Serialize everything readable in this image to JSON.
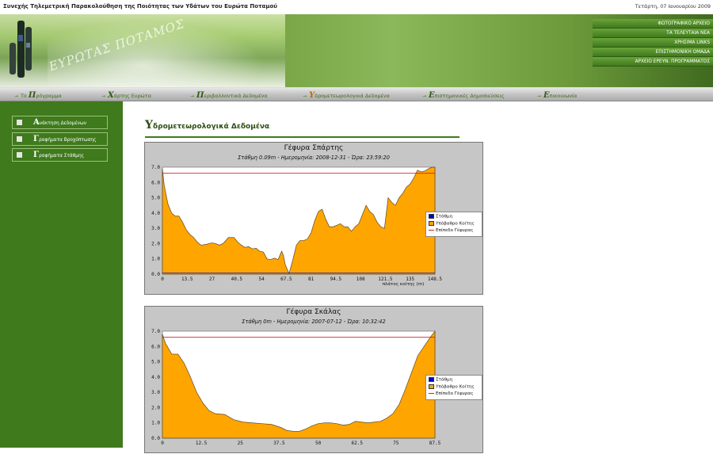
{
  "header": {
    "site_title": "Συνεχής Τηλεμετρική Παρακολούθηση της Ποιότητας των Υδάτων του Ευρώτα Ποταμού",
    "date": "Τετάρτη, 07 Ιανουαρίου 2009"
  },
  "banner": {
    "logo_text": "ΕΥΡΩΤΑΣ ΠΟΤΑΜΟΣ",
    "links": [
      "ΦΩΤΟΓΡΑΦΙΚΟ ΑΡΧΕΙΟ",
      "ΤΑ ΤΕΛΕΥΤΑΙΑ ΝΕΑ",
      "ΧΡΗΣΙΜΑ LINKS",
      "ΕΠΙΣΤΗΜΟΝΙΚΗ ΟΜΑΔΑ",
      "ΑΡΧΕΙΟ ΕΡΕΥΝ. ΠΡΟΓΡΑΜΜΑΤΟΣ"
    ]
  },
  "menu": {
    "items": [
      {
        "prefix": "Το",
        "initial": "Π",
        "rest": "ρόγραμμα",
        "active": false
      },
      {
        "prefix": "",
        "initial": "Χ",
        "rest": "άρτης Ευρώτα",
        "active": false
      },
      {
        "prefix": "",
        "initial": "Π",
        "rest": "εριβαλλοντικά Δεδομένα",
        "active": false
      },
      {
        "prefix": "",
        "initial": "Υ",
        "rest": "δρομετεωρολογικά Δεδομένα",
        "active": true
      },
      {
        "prefix": "",
        "initial": "Ε",
        "rest": "πιστημονικές Δημοσιεύσεις",
        "active": false
      },
      {
        "prefix": "",
        "initial": "Ε",
        "rest": "πικοινωνία",
        "active": false
      }
    ]
  },
  "sidebar": {
    "items": [
      {
        "initial": "Α",
        "rest": "νάκτηση Δεδομένων"
      },
      {
        "initial": "Γ",
        "rest": "ραφήματα Βροχόπτωσης"
      },
      {
        "initial": "Γ",
        "rest": "ραφήματα Στάθμης"
      }
    ]
  },
  "content": {
    "title_initial": "Υ",
    "title_rest": "δρομετεωρολογικά Δεδομένα"
  },
  "colors": {
    "green_dark": "#3f7a1d",
    "fill_orange": "#ffa500",
    "stage_blue": "#0000cc",
    "bridge_red": "#cc2222",
    "panel_grey": "#c6c6c6"
  },
  "chart_data": [
    {
      "type": "area",
      "title": "Γέφυρα Σπάρτης",
      "subtitle": "Στάθμη 0.09m - Ημερομηνία: 2008-12-31 - Ώρα: 23:59:20",
      "xlabel": "πλάτος κοίτης (m)",
      "ylabel": "",
      "xlim": [
        0,
        148.5
      ],
      "ylim": [
        0,
        7
      ],
      "xticks": [
        "0",
        "13.5",
        "27",
        "40.5",
        "54",
        "67.5",
        "81",
        "94.5",
        "108",
        "121.5",
        "135",
        "148.5"
      ],
      "yticks": [
        "0.0",
        "1.0",
        "2.0",
        "3.0",
        "4.0",
        "5.0",
        "6.0",
        "7.0"
      ],
      "legend": [
        "Στάθμη",
        "Υπόβαθρο Κοίτης",
        "Επίπεδο Γέφυρας"
      ],
      "bridge_level": 6.6,
      "stage": 0.09,
      "x": [
        0,
        1,
        3,
        5,
        7,
        9,
        11,
        13,
        15,
        17,
        19,
        21,
        24,
        27,
        29,
        31,
        33,
        36,
        39,
        41,
        43,
        45,
        47,
        49,
        51,
        53,
        55,
        57,
        59,
        61,
        63,
        65,
        66,
        67,
        69,
        71,
        73,
        75,
        77,
        79,
        81,
        83,
        85,
        87,
        89,
        91,
        93,
        95,
        97,
        99,
        101,
        103,
        105,
        107,
        109,
        111,
        113,
        115,
        117,
        119,
        121,
        123,
        125,
        127,
        129,
        131,
        133,
        135,
        137,
        139,
        141,
        143,
        145,
        147,
        148.5
      ],
      "y": [
        6.9,
        5.8,
        4.6,
        4.0,
        3.8,
        3.8,
        3.4,
        2.9,
        2.6,
        2.4,
        2.1,
        1.9,
        1.95,
        2.05,
        2.0,
        1.9,
        2.0,
        2.4,
        2.4,
        2.1,
        1.9,
        1.75,
        1.8,
        1.65,
        1.7,
        1.5,
        1.45,
        1.0,
        0.95,
        1.05,
        0.95,
        1.5,
        1.2,
        0.6,
        0.05,
        0.9,
        1.9,
        2.2,
        2.2,
        2.3,
        2.7,
        3.5,
        4.1,
        4.25,
        3.6,
        3.1,
        3.1,
        3.2,
        3.3,
        3.1,
        3.1,
        2.8,
        3.1,
        3.3,
        3.9,
        4.5,
        4.1,
        3.9,
        3.4,
        3.1,
        3.0,
        5.0,
        4.7,
        4.5,
        5.0,
        5.3,
        5.7,
        5.9,
        6.3,
        6.8,
        6.7,
        6.75,
        6.9,
        7.0,
        7.0
      ]
    },
    {
      "type": "area",
      "title": "Γέφυρα Σκάλας",
      "subtitle": "Στάθμη 0m - Ημερομηνία: 2007-07-12 - Ώρα: 10:32:42",
      "xlabel": "",
      "ylabel": "",
      "xlim": [
        0,
        87.5
      ],
      "ylim": [
        0,
        7
      ],
      "xticks": [
        "0",
        "12.5",
        "25",
        "37.5",
        "50",
        "62.5",
        "75",
        "87.5"
      ],
      "yticks": [
        "0.0",
        "1.0",
        "2.0",
        "3.0",
        "4.0",
        "5.0",
        "6.0",
        "7.0"
      ],
      "legend": [
        "Στάθμη",
        "Υπόβαθρο Κοίτης",
        "Επίπεδο Γέφυρας"
      ],
      "bridge_level": 6.6,
      "stage": 0,
      "x": [
        0,
        1,
        3,
        5,
        7,
        9,
        11,
        13,
        15,
        17,
        20,
        23,
        26,
        29,
        32,
        35,
        38,
        40,
        42,
        44,
        46,
        48,
        50,
        52,
        54,
        56,
        58,
        60,
        62,
        64,
        66,
        68,
        70,
        72,
        74,
        76,
        78,
        80,
        82,
        84,
        86,
        87.5
      ],
      "y": [
        6.8,
        6.2,
        5.5,
        5.5,
        4.9,
        4.0,
        3.0,
        2.3,
        1.8,
        1.6,
        1.55,
        1.2,
        1.05,
        1.0,
        0.95,
        0.9,
        0.7,
        0.5,
        0.45,
        0.45,
        0.6,
        0.8,
        0.95,
        1.0,
        1.0,
        0.95,
        0.85,
        0.9,
        1.1,
        1.05,
        1.0,
        1.05,
        1.1,
        1.3,
        1.6,
        2.2,
        3.2,
        4.3,
        5.4,
        6.0,
        6.6,
        7.0
      ]
    }
  ]
}
